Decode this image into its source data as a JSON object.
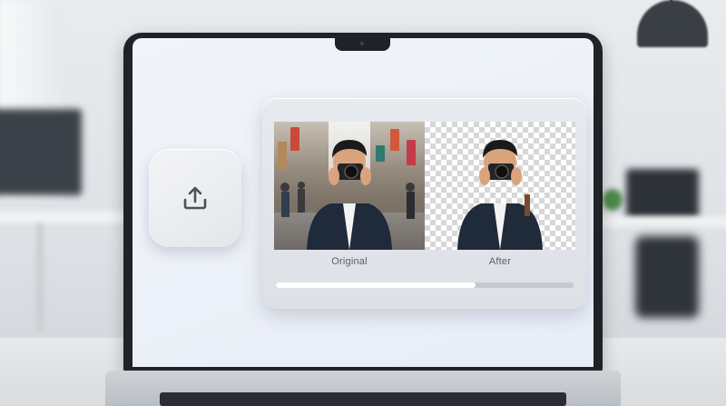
{
  "app": {
    "upload_icon": "upload-icon",
    "original_label": "Original",
    "after_label": "After",
    "progress": 0.67
  },
  "colors": {
    "screen_bg": "#eef2f8",
    "card_bg": "#e3e6ea",
    "progress_fill": "#ffffff",
    "progress_track": "#c6cace"
  }
}
